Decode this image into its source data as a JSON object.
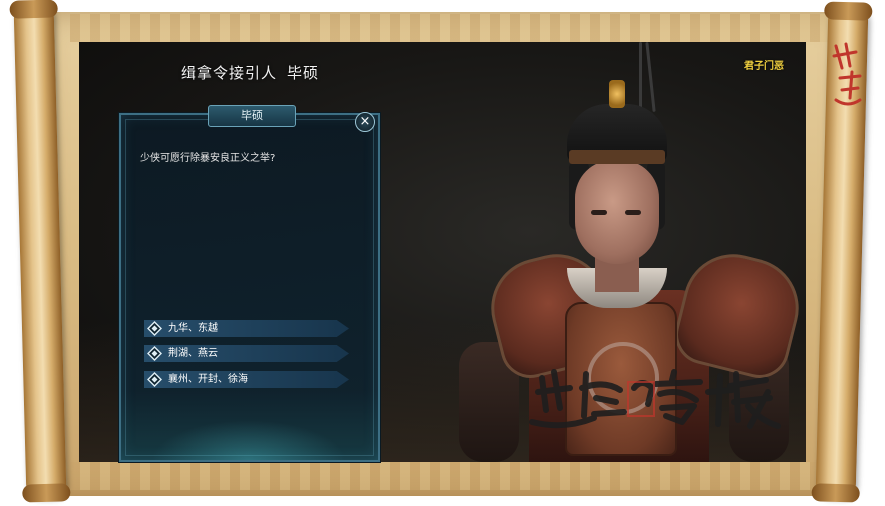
{
  "npc_title": {
    "role": "缉拿令接引人",
    "name": "毕硕"
  },
  "title_badge": "君子门恶",
  "dialog": {
    "header": "毕硕",
    "close_label": "×",
    "text": "少侠可愿行除暴安良正义之举?",
    "options": [
      {
        "label": "九华、东越",
        "icon": "diamond-icon"
      },
      {
        "label": "荆湖、燕云",
        "icon": "diamond-icon"
      },
      {
        "label": "襄州、开封、徐海",
        "icon": "diamond-icon"
      }
    ]
  },
  "watermark": {
    "text": "逍遥客栈"
  },
  "seal": {
    "text": "逍遥客栈"
  },
  "colors": {
    "accent_gold": "#f0d040",
    "panel_border": "#3d6f84",
    "option_bg": "#285070",
    "watermark": "#1e1e1e",
    "seal_red": "#c0362c"
  }
}
